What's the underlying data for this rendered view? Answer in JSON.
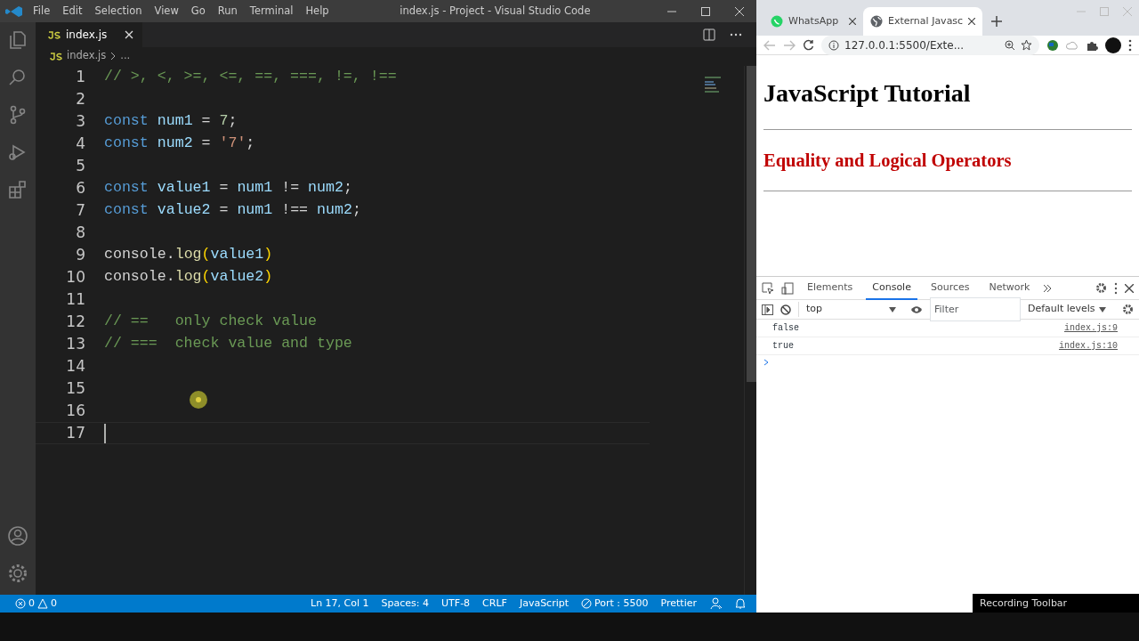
{
  "vscode": {
    "menu": [
      "File",
      "Edit",
      "Selection",
      "View",
      "Go",
      "Run",
      "Terminal",
      "Help"
    ],
    "title": "index.js - Project - Visual Studio Code",
    "tabs": [
      {
        "label": "index.js",
        "selected": true
      }
    ],
    "breadcrumb": {
      "file": "index.js",
      "more": "..."
    },
    "lines": [
      {
        "number": "1",
        "current": false,
        "tokens": [
          {
            "kind": "comment",
            "text": "// >, <, >=, <=, ==, ===, !=, !=="
          }
        ]
      },
      {
        "number": "2",
        "current": false
      },
      {
        "number": "3",
        "current": false,
        "tokens": [
          {
            "kind": "keyword",
            "text": "const"
          },
          {
            "kind": "variable",
            "text": " num1"
          },
          {
            "kind": "plain",
            "text": " = "
          },
          {
            "kind": "number",
            "text": "7"
          },
          {
            "kind": "plain",
            "text": ";"
          }
        ]
      },
      {
        "number": "4",
        "current": false,
        "tokens": [
          {
            "kind": "keyword",
            "text": "const"
          },
          {
            "kind": "variable",
            "text": " num2"
          },
          {
            "kind": "plain",
            "text": " = "
          },
          {
            "kind": "string",
            "text": "'7'"
          },
          {
            "kind": "plain",
            "text": ";"
          }
        ]
      },
      {
        "number": "5",
        "current": false
      },
      {
        "number": "6",
        "current": false,
        "tokens": [
          {
            "kind": "keyword",
            "text": "const"
          },
          {
            "kind": "variable",
            "text": " value1"
          },
          {
            "kind": "plain",
            "text": " = "
          },
          {
            "kind": "variable",
            "text": "num1"
          },
          {
            "kind": "plain",
            "text": " != "
          },
          {
            "kind": "variable",
            "text": "num2"
          },
          {
            "kind": "plain",
            "text": ";"
          }
        ]
      },
      {
        "number": "7",
        "current": false,
        "tokens": [
          {
            "kind": "keyword",
            "text": "const"
          },
          {
            "kind": "variable",
            "text": " value2"
          },
          {
            "kind": "plain",
            "text": " = "
          },
          {
            "kind": "variable",
            "text": "num1"
          },
          {
            "kind": "plain",
            "text": " !== "
          },
          {
            "kind": "variable",
            "text": "num2"
          },
          {
            "kind": "plain",
            "text": ";"
          }
        ]
      },
      {
        "number": "8",
        "current": false
      },
      {
        "number": "9",
        "current": false,
        "tokens": [
          {
            "kind": "plain",
            "text": "console."
          },
          {
            "kind": "function",
            "text": "log"
          },
          {
            "kind": "paren",
            "text": "("
          },
          {
            "kind": "variable",
            "text": "value1"
          },
          {
            "kind": "paren",
            "text": ")"
          }
        ]
      },
      {
        "number": "10",
        "current": false,
        "tokens": [
          {
            "kind": "plain",
            "text": "console."
          },
          {
            "kind": "function",
            "text": "log"
          },
          {
            "kind": "paren",
            "text": "("
          },
          {
            "kind": "variable",
            "text": "value2"
          },
          {
            "kind": "paren",
            "text": ")"
          }
        ]
      },
      {
        "number": "11",
        "current": false
      },
      {
        "number": "12",
        "current": false,
        "tokens": [
          {
            "kind": "comment",
            "text": "// ==   only check value"
          }
        ]
      },
      {
        "number": "13",
        "current": false,
        "tokens": [
          {
            "kind": "comment",
            "text": "// ===  check value and type"
          }
        ]
      },
      {
        "number": "14",
        "current": false
      },
      {
        "number": "15",
        "current": false
      },
      {
        "number": "16",
        "current": false
      },
      {
        "number": "17",
        "current": true
      }
    ],
    "status_left": {
      "errors": "0",
      "warnings": "0"
    },
    "status_right": [
      "Ln 17, Col 1",
      "Spaces: 4",
      "UTF-8",
      "CRLF",
      "JavaScript",
      "Port : 5500",
      "Prettier"
    ]
  },
  "browser": {
    "tabs": [
      {
        "label": "WhatsApp",
        "kind": "whatsapp",
        "selected": false
      },
      {
        "label": "External Javasc",
        "kind": "globe",
        "selected": true
      }
    ],
    "address": "127.0.0.1:5500/Exte...",
    "page": {
      "heading": "JavaScript Tutorial",
      "subheading": "Equality and Logical Operators"
    },
    "devtools": {
      "tabs": [
        {
          "label": "Elements",
          "selected": false
        },
        {
          "label": "Console",
          "selected": true
        },
        {
          "label": "Sources",
          "selected": false
        },
        {
          "label": "Network",
          "selected": false
        }
      ],
      "context": "top",
      "filter_placeholder": "Filter",
      "levels": "Default levels",
      "messages": [
        {
          "text": "false",
          "source": "index.js:9"
        },
        {
          "text": "true",
          "source": "index.js:10"
        }
      ]
    }
  },
  "tooltip": "Recording Toolbar"
}
